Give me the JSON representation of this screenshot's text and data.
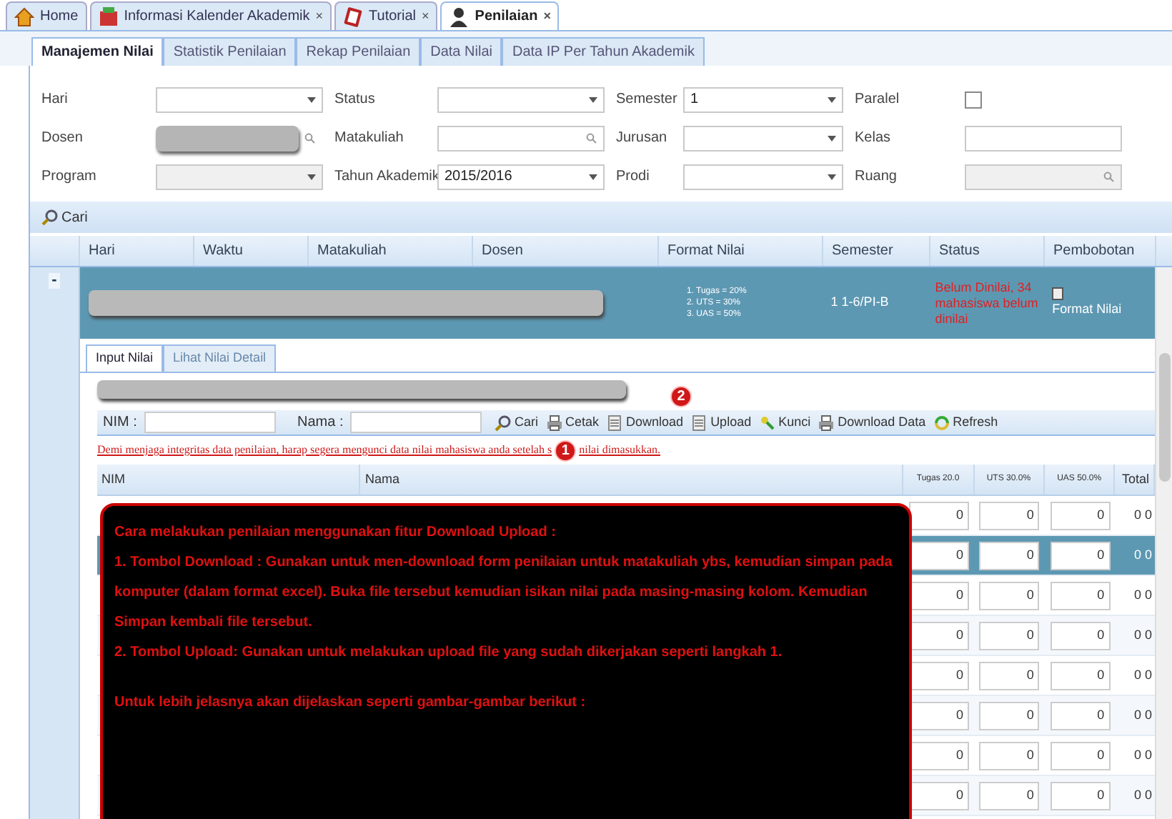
{
  "top_tabs": [
    {
      "label": "Home",
      "kind": "home",
      "closable": false,
      "selected": false
    },
    {
      "label": "Informasi Kalender Akademik",
      "kind": "calendar",
      "closable": true,
      "selected": false
    },
    {
      "label": "Tutorial",
      "kind": "book",
      "closable": true,
      "selected": false
    },
    {
      "label": "Penilaian",
      "kind": "user",
      "closable": true,
      "selected": true
    }
  ],
  "close_glyph": "×",
  "sub_tabs": [
    {
      "label": "Manajemen Nilai",
      "selected": true
    },
    {
      "label": "Statistik Penilaian",
      "selected": false
    },
    {
      "label": "Rekap Penilaian",
      "selected": false
    },
    {
      "label": "Data Nilai",
      "selected": false
    },
    {
      "label": "Data IP Per Tahun Akademik",
      "selected": false
    }
  ],
  "filters": [
    [
      {
        "label": "Hari",
        "kind": "select"
      },
      {
        "label": "Status",
        "kind": "select"
      },
      {
        "label": "Semester",
        "kind": "select",
        "value": "1"
      },
      {
        "label": "Paralel",
        "kind": "checkbox",
        "checked": false
      }
    ],
    [
      {
        "label": "Dosen",
        "kind": "redacted"
      },
      {
        "label": "Matakuliah",
        "kind": "search"
      },
      {
        "label": "Jurusan",
        "kind": "select"
      },
      {
        "label": "Kelas",
        "kind": "text"
      }
    ],
    [
      {
        "label": "Program",
        "kind": "select",
        "disabled": true
      },
      {
        "label": "Tahun Akademik",
        "kind": "select",
        "value": "2015/2016"
      },
      {
        "label": "Prodi",
        "kind": "select"
      },
      {
        "label": "Ruang",
        "kind": "search",
        "disabled": true
      }
    ]
  ],
  "search_button": "Cari",
  "grid": {
    "columns": [
      "Hari",
      "Waktu",
      "Matakuliah",
      "Dosen",
      "Format Nilai",
      "Semester",
      "Status",
      "Pembobotan"
    ],
    "row": {
      "expander": "-",
      "expanded": true,
      "selected": true,
      "format_nilai": [
        "1. Tugas = 20%",
        "2. UTS = 30%",
        "3. UAS = 50%"
      ],
      "semester": "1 1-6/PI-B",
      "status": "Belum Dinilai, 34 mahasiswa belum dinilai",
      "pembobotan": "Format Nilai"
    }
  },
  "inner_tabs": [
    {
      "label": "Input Nilai",
      "selected": true
    },
    {
      "label": "Lihat Nilai Detail",
      "selected": false
    }
  ],
  "toolbar": {
    "nim_label": "NIM :",
    "nama_label": "Nama :",
    "buttons": [
      {
        "label": "Cari",
        "kind": "search"
      },
      {
        "label": "Cetak",
        "kind": "print"
      },
      {
        "label": "Download",
        "kind": "file"
      },
      {
        "label": "Upload",
        "kind": "file"
      },
      {
        "label": "Kunci",
        "kind": "key"
      },
      {
        "label": "Download Data",
        "kind": "print"
      },
      {
        "label": "Refresh",
        "kind": "refresh"
      }
    ]
  },
  "badges": [
    "1",
    "2"
  ],
  "warning": [
    "Demi menjaga integritas data penilaian, harap segera mengunci data nilai mahasiswa anda setelah s",
    "nilai dimasukkan."
  ],
  "table": {
    "columns": [
      "NIM",
      "Nama",
      "Tugas 20.0",
      "UTS 30.0%",
      "UAS 50.0%",
      "Total"
    ],
    "rows": [
      {
        "tugas": "0",
        "uts": "0",
        "uas": "0",
        "total": "0 0",
        "selected": false
      },
      {
        "tugas": "0",
        "uts": "0",
        "uas": "0",
        "total": "0 0",
        "selected": true
      },
      {
        "tugas": "0",
        "uts": "0",
        "uas": "0",
        "total": "0 0",
        "selected": false
      },
      {
        "tugas": "0",
        "uts": "0",
        "uas": "0",
        "total": "0 0",
        "selected": false
      },
      {
        "tugas": "0",
        "uts": "0",
        "uas": "0",
        "total": "0 0",
        "selected": false
      },
      {
        "tugas": "0",
        "uts": "0",
        "uas": "0",
        "total": "0 0",
        "selected": false
      },
      {
        "tugas": "0",
        "uts": "0",
        "uas": "0",
        "total": "0 0",
        "selected": false
      },
      {
        "tugas": "0",
        "uts": "0",
        "uas": "0",
        "total": "0 0",
        "selected": false
      }
    ]
  },
  "callout": [
    "Cara melakukan penilaian menggunakan fitur Download Upload :",
    "1. Tombol Download : Gunakan untuk men-download form penilaian untuk matakuliah ybs, kemudian simpan pada komputer (dalam format excel). Buka file tersebut kemudian isikan nilai pada masing-masing kolom. Kemudian Simpan kembali file tersebut.",
    "2. Tombol Upload: Gunakan untuk melakukan upload file yang sudah dikerjakan seperti langkah 1.",
    "Untuk lebih jelasnya akan dijelaskan seperti gambar-gambar berikut :"
  ]
}
